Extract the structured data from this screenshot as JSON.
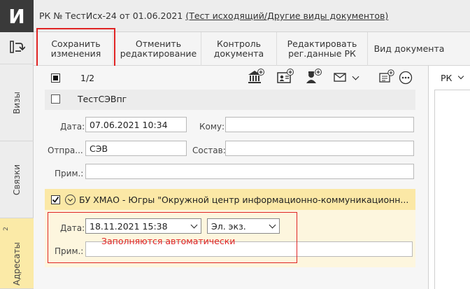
{
  "app": {
    "logo_letter": "И"
  },
  "window": {
    "title_prefix": "РК № ТестИсх-24 от 01.06.2021",
    "title_link": "(Тест исходящий/Другие виды документов)"
  },
  "left_rail": {
    "tabs": [
      {
        "label": "Визы"
      },
      {
        "label": "Связки"
      },
      {
        "label": "Адресаты",
        "badge": "2"
      }
    ]
  },
  "toolbar": {
    "buttons": [
      {
        "label_line1": "Сохранить",
        "label_line2": "изменения"
      },
      {
        "label_line1": "Отменить",
        "label_line2": "редактирование"
      },
      {
        "label_line1": "Контроль",
        "label_line2": "документа"
      },
      {
        "label_line1": "Редактировать",
        "label_line2": "рег.данные РК"
      },
      {
        "label_line1": "Вид документа",
        "label_line2": ""
      }
    ]
  },
  "recipients_bar": {
    "page": "1/2"
  },
  "recipient1": {
    "name": "ТестСЭВпг",
    "date_label": "Дата:",
    "date_value": "07.06.2021 10:34",
    "to_label": "Кому:",
    "to_value": "",
    "sent_label": "Отпра...",
    "sent_value": "СЭВ",
    "composition_label": "Состав:",
    "composition_value": "",
    "note_label": "Прим.:",
    "note_value": ""
  },
  "recipient2": {
    "name": "БУ ХМАО - Югры \"Окружной центр информационно-коммуникационн...",
    "date_label": "Дата:",
    "date_value": "18.11.2021 15:38",
    "copy_type": "Эл. экз.",
    "note_label": "Прим.:",
    "note_value": "",
    "auto_note": "Заполняются автоматически"
  },
  "right_panel": {
    "label": "РК"
  },
  "icons": [
    "refresh-doc-icon",
    "institution-add-icon",
    "contact-card-add-icon",
    "person-add-icon",
    "envelope-icon",
    "chevron-down-icon",
    "comment-add-icon",
    "more-icon",
    "chevron-circle-icon"
  ],
  "colors": {
    "accent_yellow": "#fbe8a6",
    "highlight_red": "#e02424"
  }
}
